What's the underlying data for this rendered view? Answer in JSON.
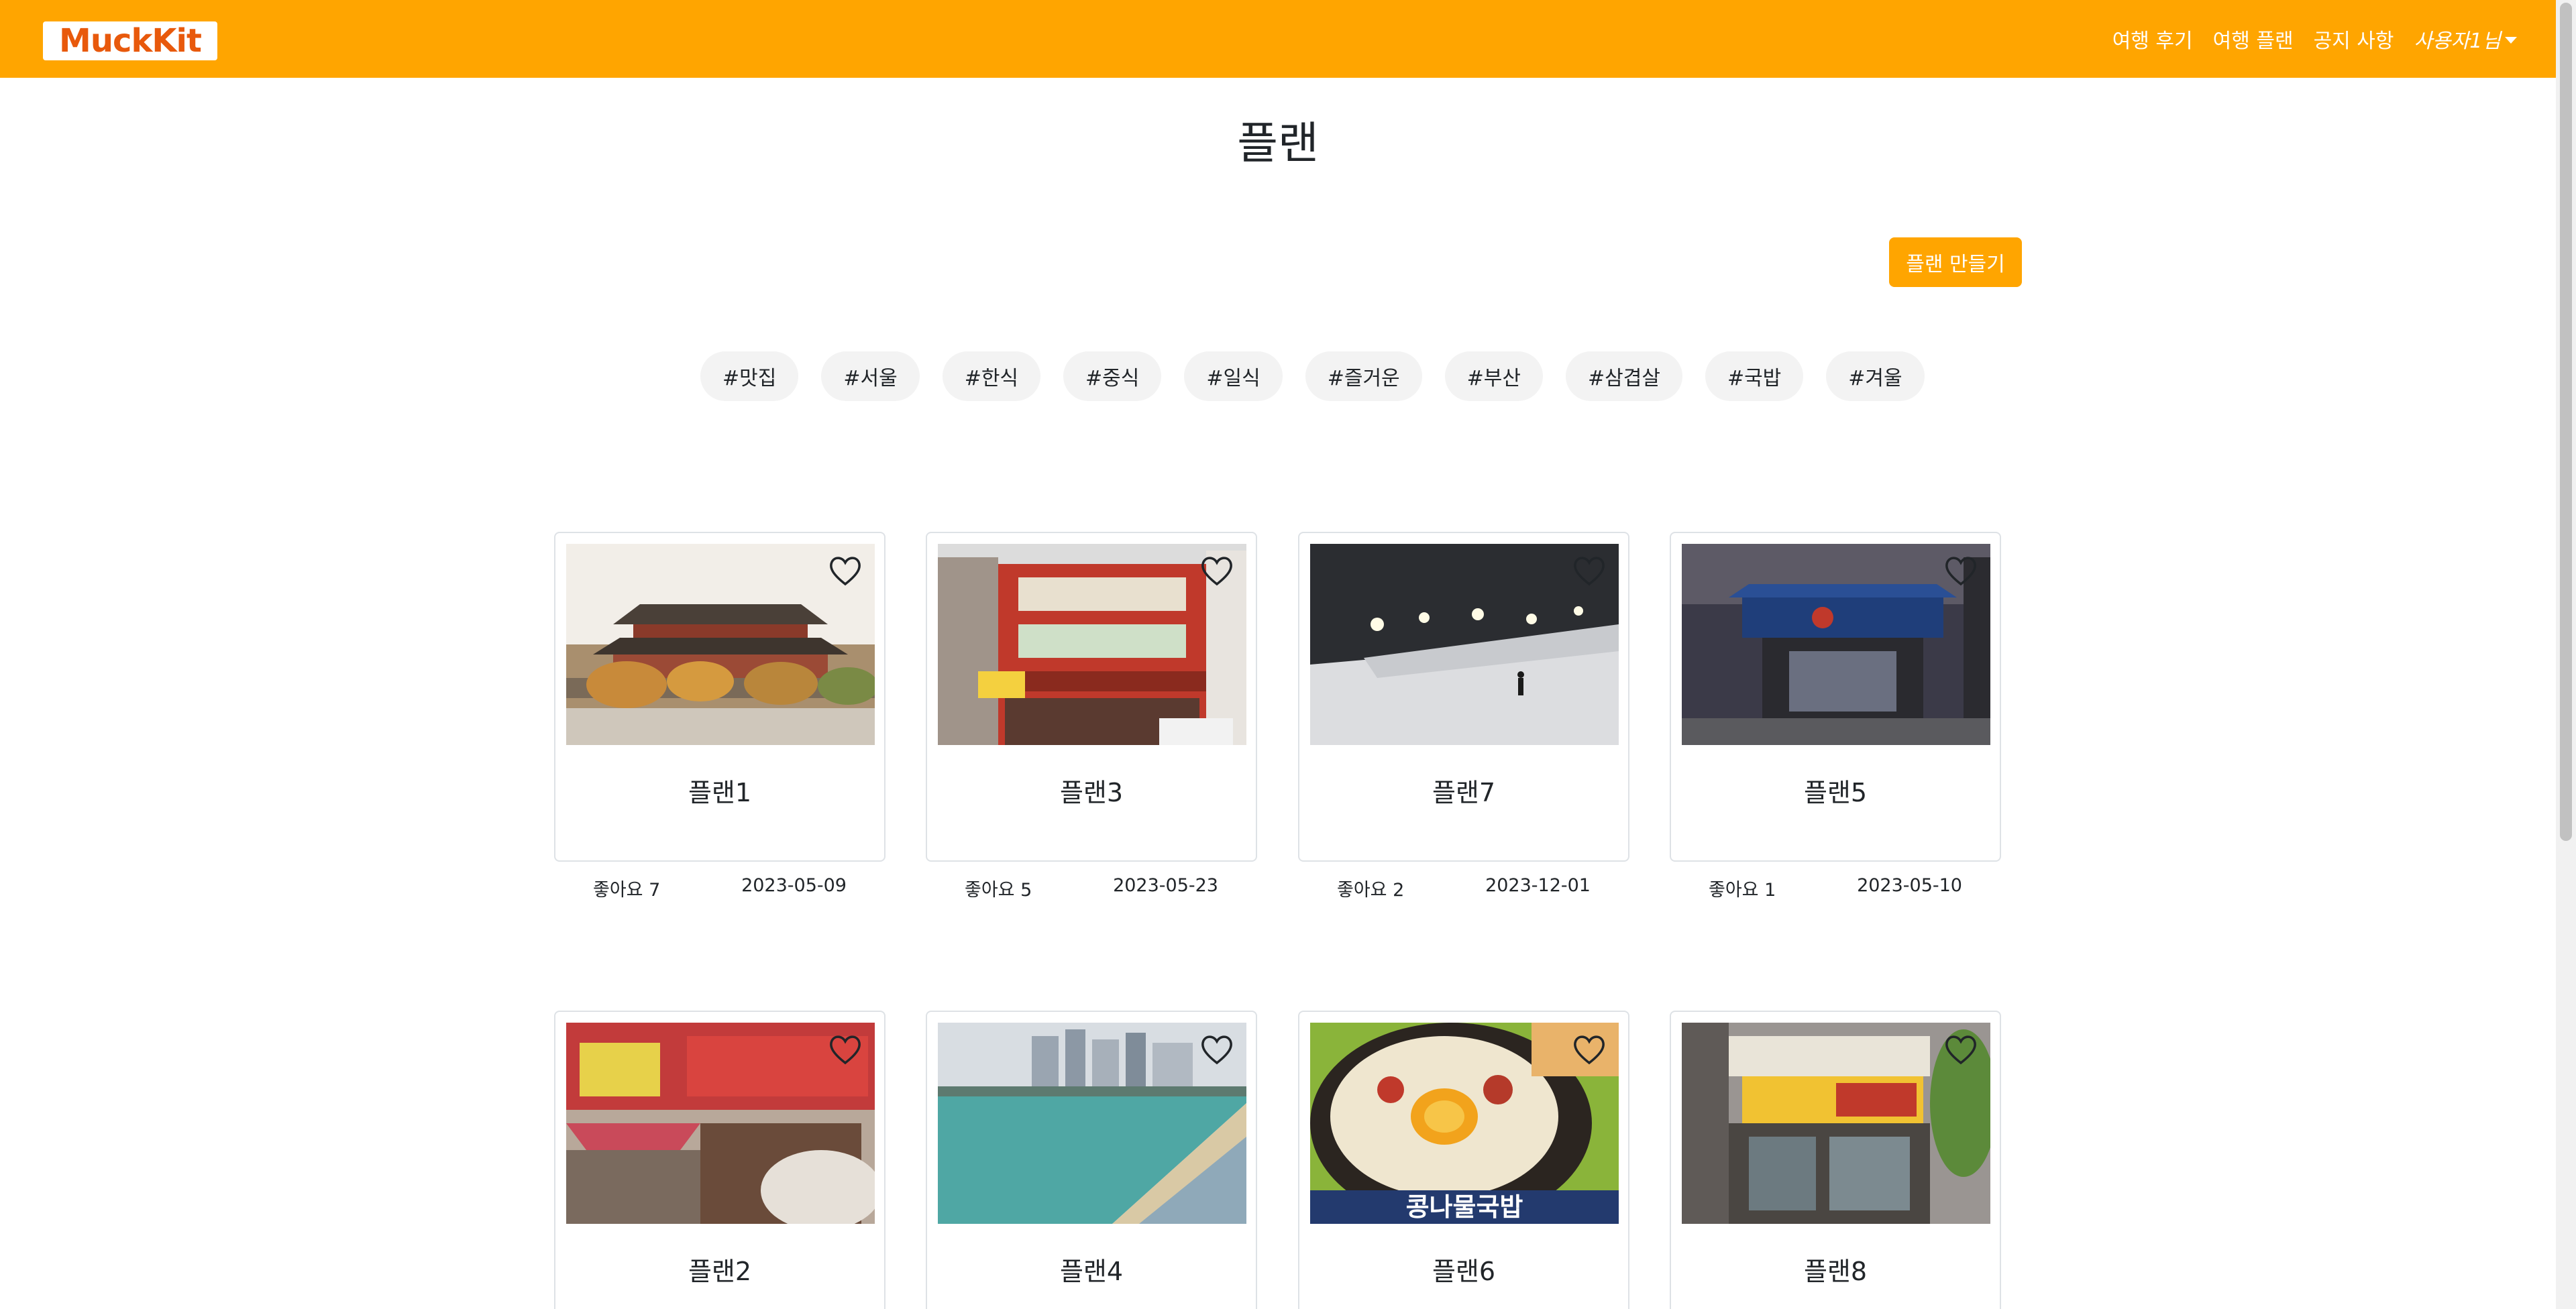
{
  "navbar": {
    "logo": "MuckKit",
    "links": [
      "여행 후기",
      "여행 플랜",
      "공지 사항"
    ],
    "user": "사용자1님"
  },
  "page": {
    "title": "플랜",
    "create_button": "플랜 만들기"
  },
  "tags": [
    "#맛집",
    "#서울",
    "#한식",
    "#중식",
    "#일식",
    "#즐거운",
    "#부산",
    "#삼겹살",
    "#국밥",
    "#겨울"
  ],
  "cards": [
    {
      "title": "플랜1",
      "likes": "좋아요 7",
      "date": "2023-05-09",
      "image": "palace"
    },
    {
      "title": "플랜3",
      "likes": "좋아요 5",
      "date": "2023-05-23",
      "image": "red-building"
    },
    {
      "title": "플랜7",
      "likes": "좋아요 2",
      "date": "2023-12-01",
      "image": "ski-slope-night"
    },
    {
      "title": "플랜5",
      "likes": "좋아요 1",
      "date": "2023-05-10",
      "image": "restaurant-night"
    },
    {
      "title": "플랜2",
      "image": "gukbap-restaurant"
    },
    {
      "title": "플랜4",
      "image": "beach"
    },
    {
      "title": "플랜6",
      "image": "noodle-bowl"
    },
    {
      "title": "플랜8",
      "image": "kalguksu-storefront"
    }
  ],
  "card_image_captions": {
    "noodle": "콩나물국밥"
  },
  "colors": {
    "brand": "#ffa500",
    "tag_bg": "#f3f3f3",
    "card_border": "#dee2e6"
  }
}
